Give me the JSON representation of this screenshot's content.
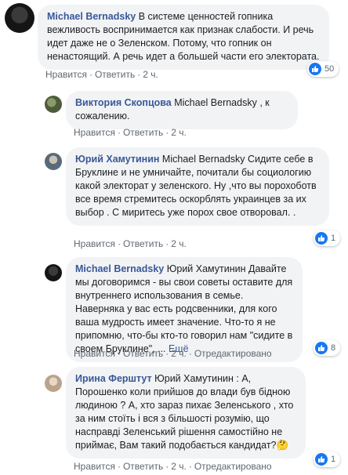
{
  "comments": [
    {
      "author": "Michael Bernadsky",
      "tag": "",
      "text": "В системе ценностей гопника вежливость воспринимается как признак слабости. И речь идет даже не о Зеленском. Потому, что гопник он ненастоящий. А речь идет а большей части его электората.",
      "like_label": "Нравится",
      "reply_label": "Ответить",
      "time": "2 ч.",
      "reactions": "50"
    },
    {
      "author": "Виктория Скопцова",
      "tag": "Michael Bernadsky",
      "text": ", к сожалению.",
      "like_label": "Нравится",
      "reply_label": "Ответить",
      "time": "2 ч."
    },
    {
      "author": "Юрий Хамутинин",
      "tag": "Michael Bernadsky",
      "text": "Сидите себе в Бруклине и не умничайте, почитали бы социологию какой электорат у зеленского. Ну ,что вы порохоботв все время стремитесь оскорблять украинцев за их выбор . С миритесь уже порох свое отворовал. .",
      "like_label": "Нравится",
      "reply_label": "Ответить",
      "time": "2 ч.",
      "reactions": "1"
    },
    {
      "author": "Michael Bernadsky",
      "tag": "Юрий Хамутинин",
      "text": "Давайте мы договоримся - вы свои советы оставите для внутреннего использования в семье. Наверняка у вас есть родсвенники, для кого ваша мудрость имеет значение. Что-то я не припомню, что-бы кто-то говорил нам \"сидите в своем Бруклине\", ...",
      "more": "Ещё",
      "like_label": "Нравится",
      "reply_label": "Ответить",
      "hide_label": "Отредактировано",
      "time": "2 ч.",
      "reactions": "8"
    },
    {
      "author": "Ирина Ферштут",
      "tag": "Юрий Хамутинин",
      "text": ": А, Порошенко коли прийшов до влади був бідною людиною ? А, хто зараз пихає Зеленського , хто за ним стоїть і вся з більшості розумію, що насправді Зеленський рішення самостійно не приймає, Вам такий подобається кандидат?🤔",
      "like_label": "Нравится",
      "reply_label": "Ответить",
      "hide_label": "Отредактировано",
      "time": "2 ч.",
      "reactions": "1"
    }
  ],
  "colors": {
    "link": "#385898",
    "bubble": "#f2f3f5",
    "meta": "#606770",
    "like": "#1877f2"
  },
  "icons": [
    "avatar",
    "like-icon"
  ]
}
